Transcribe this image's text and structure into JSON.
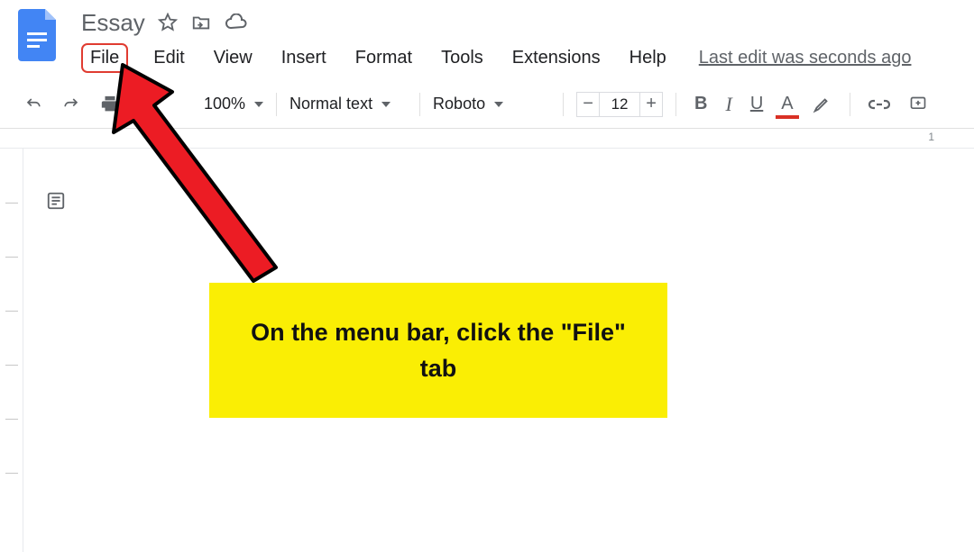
{
  "header": {
    "title": "Essay",
    "last_edit": "Last edit was seconds ago"
  },
  "menubar": {
    "items": [
      "File",
      "Edit",
      "View",
      "Insert",
      "Format",
      "Tools",
      "Extensions",
      "Help"
    ]
  },
  "toolbar": {
    "zoom": "100%",
    "style": "Normal text",
    "font": "Roboto",
    "font_size": "12",
    "bold": "B",
    "italic": "I",
    "underline": "U",
    "text_color": "A"
  },
  "ruler": {
    "mark": "1"
  },
  "callout": {
    "text": "On the menu bar, click the \"File\" tab"
  }
}
